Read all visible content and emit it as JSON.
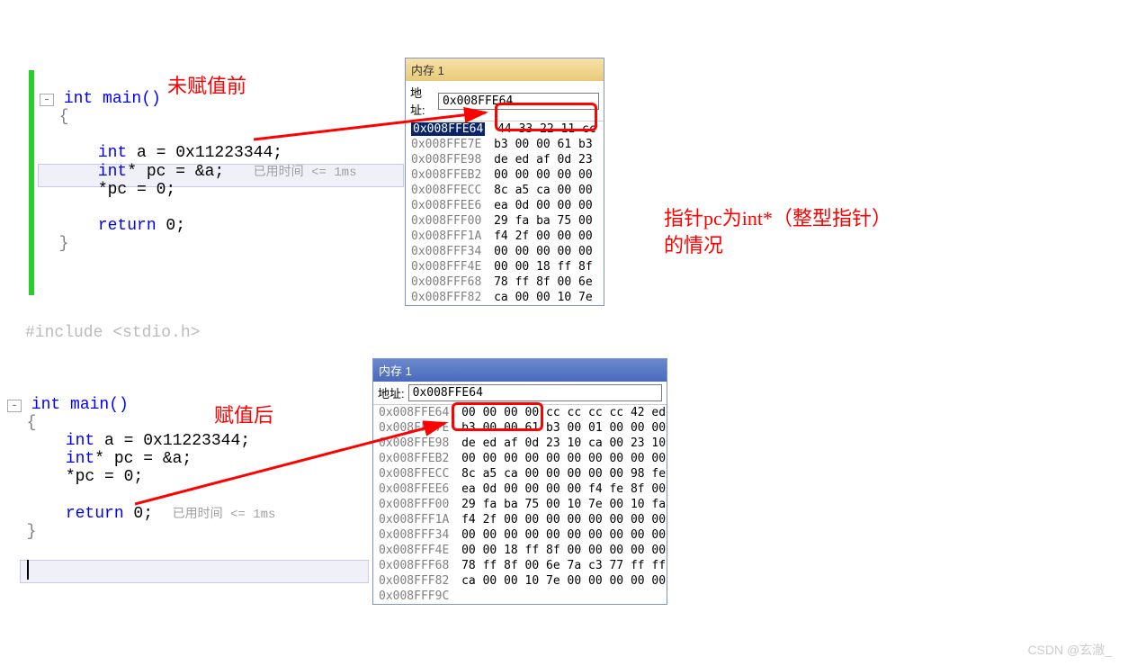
{
  "annotations": {
    "before": "未赋值前",
    "after": "赋值后",
    "right_note_line1": "指针pc为int*（整型指针）",
    "right_note_line2": "的情况",
    "timing": "已用时间 <= 1ms",
    "timing2": "已用时间 <= 1ms"
  },
  "code1": {
    "sig": "int main()",
    "brace_open": "{",
    "l1_kw": "int",
    "l1_rest": " a = 0x11223344;",
    "l2_kw": "int",
    "l2_rest": "* pc = &a;",
    "l3": "*pc = 0;",
    "ret_kw": "return",
    "ret_rest": " 0;",
    "brace_close": "}"
  },
  "include_line": "#include <stdio.h>",
  "code2": {
    "sig": "int main()",
    "brace_open": "{",
    "l1_kw": "int",
    "l1_rest": " a = 0x11223344;",
    "l2_kw": "int",
    "l2_rest": "* pc = &a;",
    "l3": "*pc = 0;",
    "ret_kw": "return",
    "ret_rest": " 0;",
    "brace_close": "}"
  },
  "mem1": {
    "title": "内存 1",
    "addr_label": "地址:",
    "addr_value": "0x008FFE64",
    "rows": [
      {
        "addr": "0x008FFE64",
        "bytes": "44 33 22 11 cc",
        "hl": true
      },
      {
        "addr": "0x008FFE7E",
        "bytes": "b3 00 00 61 b3"
      },
      {
        "addr": "0x008FFE98",
        "bytes": "de ed af 0d 23"
      },
      {
        "addr": "0x008FFEB2",
        "bytes": "00 00 00 00 00"
      },
      {
        "addr": "0x008FFECC",
        "bytes": "8c a5 ca 00 00"
      },
      {
        "addr": "0x008FFEE6",
        "bytes": "ea 0d 00 00 00"
      },
      {
        "addr": "0x008FFF00",
        "bytes": "29 fa ba 75 00"
      },
      {
        "addr": "0x008FFF1A",
        "bytes": "f4 2f 00 00 00"
      },
      {
        "addr": "0x008FFF34",
        "bytes": "00 00 00 00 00"
      },
      {
        "addr": "0x008FFF4E",
        "bytes": "00 00 18 ff 8f"
      },
      {
        "addr": "0x008FFF68",
        "bytes": "78 ff 8f 00 6e"
      },
      {
        "addr": "0x008FFF82",
        "bytes": "ca 00 00 10 7e"
      }
    ]
  },
  "mem2": {
    "title": "内存 1",
    "addr_label": "地址:",
    "addr_value": "0x008FFE64",
    "rows": [
      {
        "addr": "0x008FFE64",
        "bytes": "00 00 00 00 cc cc cc cc 42 ed"
      },
      {
        "addr": "0x008FFE7E",
        "bytes": "b3 00 00 61 b3 00 01 00 00 00"
      },
      {
        "addr": "0x008FFE98",
        "bytes": "de ed af 0d 23 10 ca 00 23 10"
      },
      {
        "addr": "0x008FFEB2",
        "bytes": "00 00 00 00 00 00 00 00 00 00"
      },
      {
        "addr": "0x008FFECC",
        "bytes": "8c a5 ca 00 00 00 00 00 98 fe"
      },
      {
        "addr": "0x008FFEE6",
        "bytes": "ea 0d 00 00 00 00 f4 fe 8f 00"
      },
      {
        "addr": "0x008FFF00",
        "bytes": "29 fa ba 75 00 10 7e 00 10 fa"
      },
      {
        "addr": "0x008FFF1A",
        "bytes": "f4 2f 00 00 00 00 00 00 00 00"
      },
      {
        "addr": "0x008FFF34",
        "bytes": "00 00 00 00 00 00 00 00 00 00"
      },
      {
        "addr": "0x008FFF4E",
        "bytes": "00 00 18 ff 8f 00 00 00 00 00"
      },
      {
        "addr": "0x008FFF68",
        "bytes": "78 ff 8f 00 6e 7a c3 77 ff ff"
      },
      {
        "addr": "0x008FFF82",
        "bytes": "ca 00 00 10 7e 00 00 00 00 00"
      },
      {
        "addr": "0x008FFF9C",
        "bytes": ""
      }
    ]
  },
  "watermark": "CSDN @玄澈_"
}
